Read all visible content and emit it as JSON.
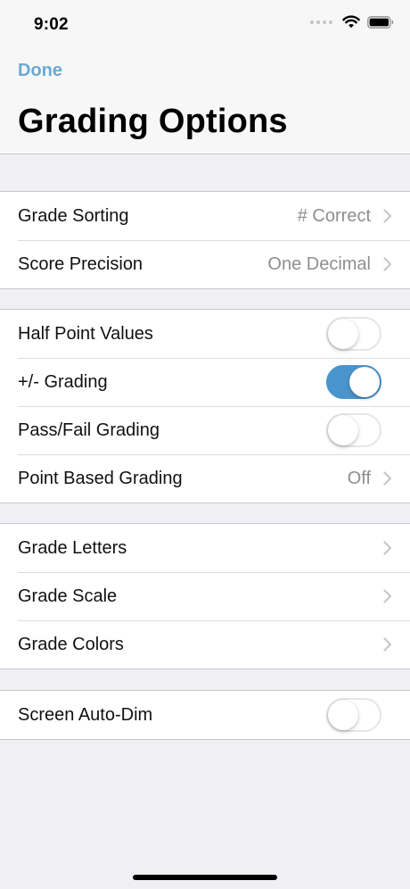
{
  "status_bar": {
    "time": "9:02",
    "icons": [
      "cellular-dots-icon",
      "wifi-icon",
      "battery-icon"
    ]
  },
  "nav": {
    "done_label": "Done",
    "title": "Grading Options"
  },
  "colors": {
    "accent": "#6aa9d4",
    "toggle_on": "#4a94cc",
    "background": "#efeff4",
    "value_gray": "#8e8e93"
  },
  "sections": [
    {
      "rows": [
        {
          "label": "Grade Sorting",
          "value": "# Correct",
          "control": "disclosure"
        },
        {
          "label": "Score Precision",
          "value": "One Decimal",
          "control": "disclosure"
        }
      ]
    },
    {
      "rows": [
        {
          "label": "Half Point Values",
          "control": "toggle",
          "on": false
        },
        {
          "label": "+/- Grading",
          "control": "toggle",
          "on": true
        },
        {
          "label": "Pass/Fail Grading",
          "control": "toggle",
          "on": false
        },
        {
          "label": "Point Based Grading",
          "value": "Off",
          "control": "disclosure"
        }
      ]
    },
    {
      "rows": [
        {
          "label": "Grade Letters",
          "control": "disclosure"
        },
        {
          "label": "Grade Scale",
          "control": "disclosure"
        },
        {
          "label": "Grade Colors",
          "control": "disclosure"
        }
      ]
    },
    {
      "rows": [
        {
          "label": "Screen Auto-Dim",
          "control": "toggle",
          "on": false
        }
      ]
    }
  ]
}
